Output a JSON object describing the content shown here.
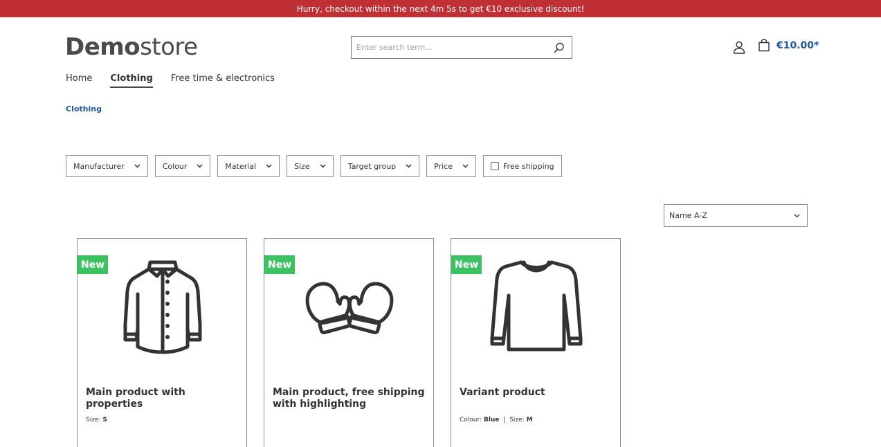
{
  "promo": {
    "text": "Hurry, checkout within the next 4m 5s to get €10 exclusive discount!"
  },
  "header": {
    "logo_bold": "Demo",
    "logo_light": "store",
    "search_placeholder": "Enter search term...",
    "cart_total": "€10.00*"
  },
  "nav": {
    "items": [
      {
        "label": "Home"
      },
      {
        "label": "Clothing"
      },
      {
        "label": "Free time & electronics"
      }
    ]
  },
  "breadcrumb": {
    "current": "Clothing"
  },
  "filters": {
    "manufacturer": "Manufacturer",
    "colour": "Colour",
    "material": "Material",
    "size": "Size",
    "target_group": "Target group",
    "price": "Price",
    "free_shipping": "Free shipping"
  },
  "sort": {
    "selected": "Name A-Z"
  },
  "products": [
    {
      "badge": "New",
      "name": "Main product with properties",
      "icon": "jacket-icon",
      "prop1_label": "Size:",
      "prop1_value": "S"
    },
    {
      "badge": "New",
      "name": "Main product, free shipping with highlighting",
      "icon": "mittens-icon"
    },
    {
      "badge": "New",
      "name": "Variant product",
      "icon": "sweater-icon",
      "prop1_label": "Colour:",
      "prop1_value": "Blue",
      "prop_separator": "|",
      "prop2_label": "Size:",
      "prop2_value": "M"
    }
  ],
  "colors": {
    "promo_bg": "#bf2f33",
    "accent_blue": "#1e5aa0",
    "badge_green": "#3cc261"
  }
}
